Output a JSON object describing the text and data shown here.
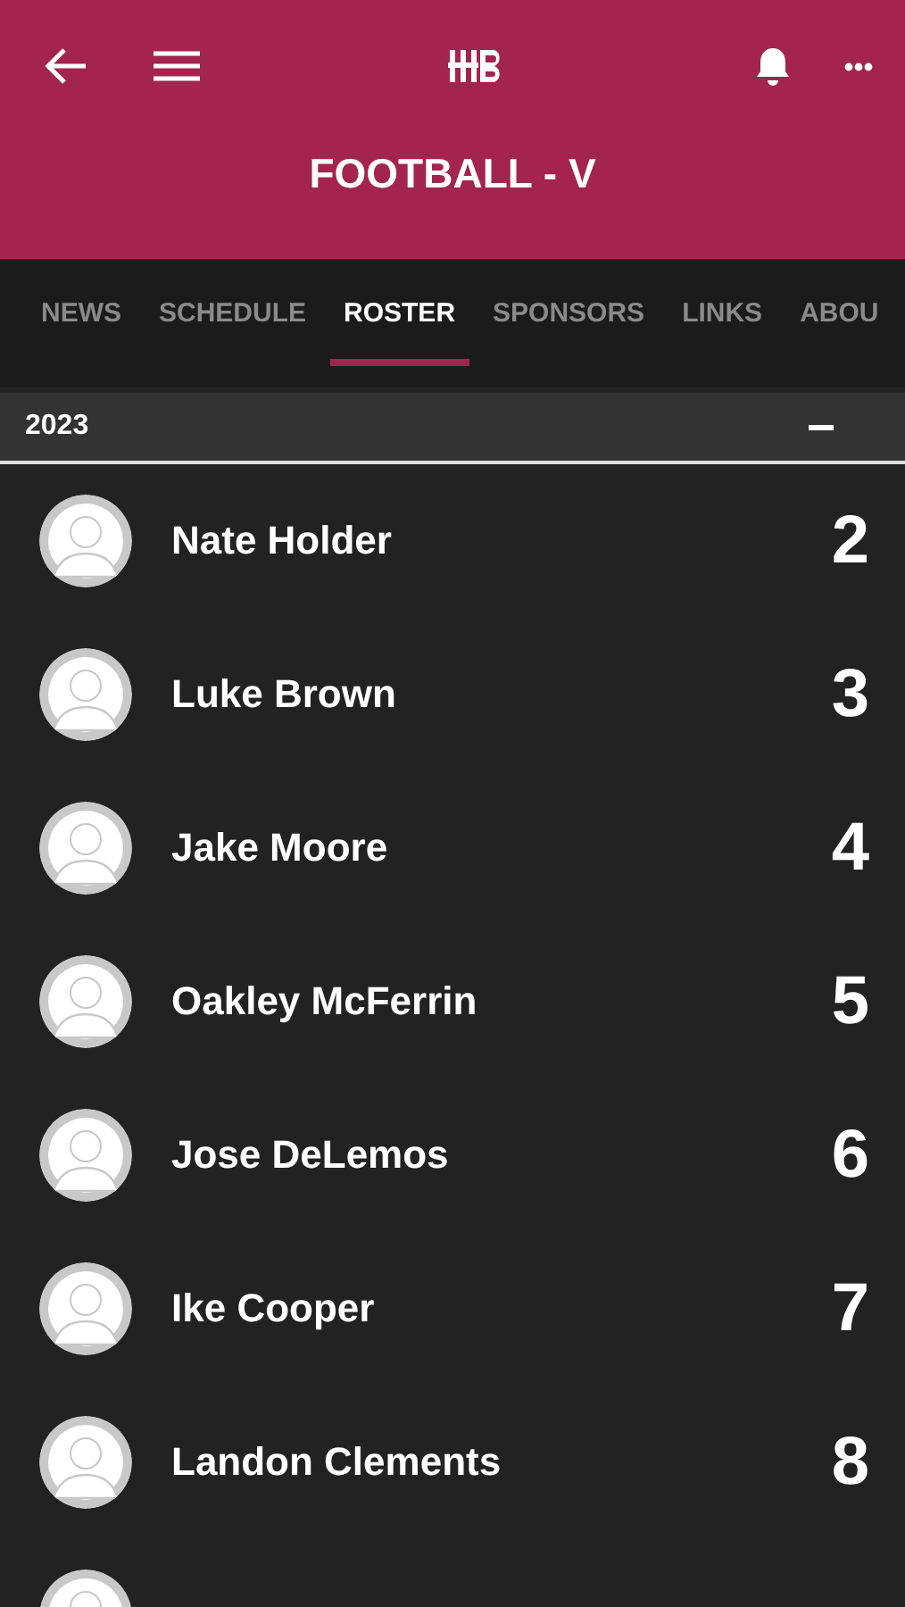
{
  "header": {
    "title": "FOOTBALL - V"
  },
  "tabs": [
    {
      "label": "NEWS",
      "selected": false
    },
    {
      "label": "SCHEDULE",
      "selected": false
    },
    {
      "label": "ROSTER",
      "selected": true
    },
    {
      "label": "SPONSORS",
      "selected": false
    },
    {
      "label": "LINKS",
      "selected": false
    },
    {
      "label": "ABOU",
      "selected": false
    }
  ],
  "section": {
    "label": "2023",
    "expanded": true
  },
  "players": [
    {
      "kind": "player",
      "name": "Nate Holder",
      "number": "2"
    },
    {
      "kind": "player",
      "name": "Luke Brown",
      "number": "3"
    },
    {
      "kind": "player",
      "name": "Jake Moore",
      "number": "4"
    },
    {
      "kind": "player",
      "name": "Oakley McFerrin",
      "number": "5"
    },
    {
      "kind": "player",
      "name": "Jose DeLemos",
      "number": "6"
    },
    {
      "kind": "player",
      "name": "Ike Cooper",
      "number": "7"
    },
    {
      "kind": "player",
      "name": "Landon Clements",
      "number": "8"
    },
    {
      "kind": "cut"
    }
  ]
}
